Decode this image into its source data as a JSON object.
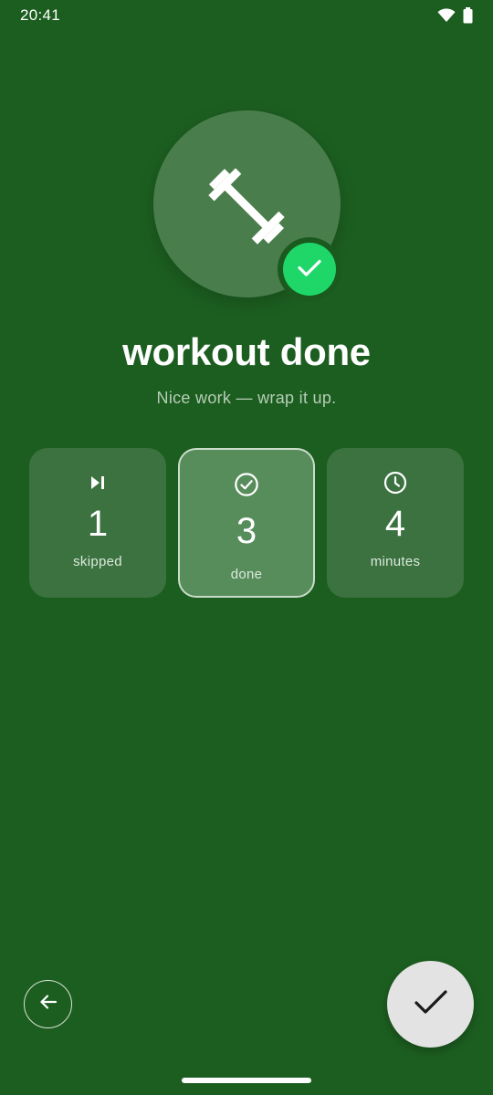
{
  "status_bar": {
    "time": "20:41",
    "icons": [
      "wifi-icon",
      "battery-icon"
    ]
  },
  "hero": {
    "icon": "dumbbell-icon",
    "badge_icon": "check-icon"
  },
  "title": "workout done",
  "subtitle": "Nice work — wrap it up.",
  "stats": [
    {
      "icon": "skip-next-icon",
      "value": "1",
      "label": "skipped"
    },
    {
      "icon": "check-circle-icon",
      "value": "3",
      "label": "done"
    },
    {
      "icon": "clock-icon",
      "value": "4",
      "label": "minutes"
    }
  ],
  "colors": {
    "background": "#1c5e20",
    "badge_green": "#1fd769",
    "card": "#3b7240",
    "card_active": "#578c5b",
    "fab": "#e3e3e3"
  },
  "actions": {
    "back_icon": "arrow-left-icon",
    "done_icon": "check-icon"
  }
}
